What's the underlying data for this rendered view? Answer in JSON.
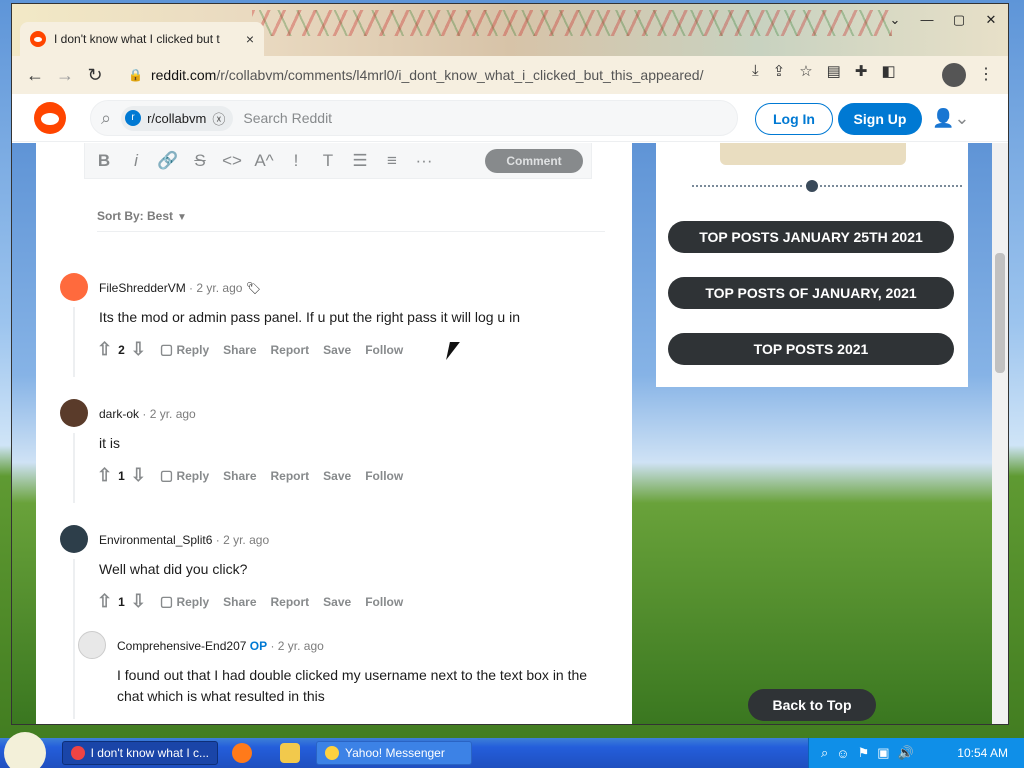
{
  "browser": {
    "tab_title": "I don't know what I clicked but t",
    "tab_close": "×",
    "url_host": "reddit.com",
    "url_path": "/r/collabvm/comments/l4mrl0/i_dont_know_what_i_clicked_but_this_appeared/",
    "back_icon": "back-arrow-icon",
    "forward_icon": "forward-arrow-icon",
    "reload_icon": "reload-icon"
  },
  "reddit_header": {
    "subreddit_chip": "r/collabvm",
    "search_placeholder": "Search Reddit",
    "login_label": "Log In",
    "signup_label": "Sign Up"
  },
  "editor": {
    "comment_button": "Comment",
    "tools": [
      "B",
      "i",
      "🔗",
      "S",
      "<>",
      "A^",
      "!",
      "T",
      "☰",
      "≡",
      "···"
    ]
  },
  "sort": {
    "label": "Sort By: Best"
  },
  "comments": [
    {
      "username": "FileShredderVM",
      "time": "2 yr. ago",
      "body": "Its the mod or admin pass panel. If u put the right pass it will log u in",
      "score": "2",
      "op": ""
    },
    {
      "username": "dark-ok",
      "time": "2 yr. ago",
      "body": "it is",
      "score": "1",
      "op": ""
    },
    {
      "username": "Environmental_Split6",
      "time": "2 yr. ago",
      "body": "Well what did you click?",
      "score": "1",
      "op": ""
    },
    {
      "username": "Comprehensive-End207",
      "time": "2 yr. ago",
      "body": "I found out that I had double clicked my username next to the text box in the chat which is what resulted in this",
      "score": "",
      "op": "OP"
    }
  ],
  "actions": {
    "reply": "Reply",
    "share": "Share",
    "report": "Report",
    "save": "Save",
    "follow": "Follow"
  },
  "sidebar": {
    "buttons": [
      "TOP POSTS JANUARY 25TH 2021",
      "TOP POSTS OF JANUARY, 2021",
      "TOP POSTS 2021"
    ],
    "back_to_top": "Back to Top"
  },
  "taskbar": {
    "task_browser": "I don't know what I c...",
    "task_messenger": "Yahoo! Messenger",
    "clock": "10:54 AM"
  },
  "colors": {
    "reddit_orange": "#ff4500",
    "reddit_blue": "#0079d3",
    "pill_dark": "#2f3336"
  }
}
